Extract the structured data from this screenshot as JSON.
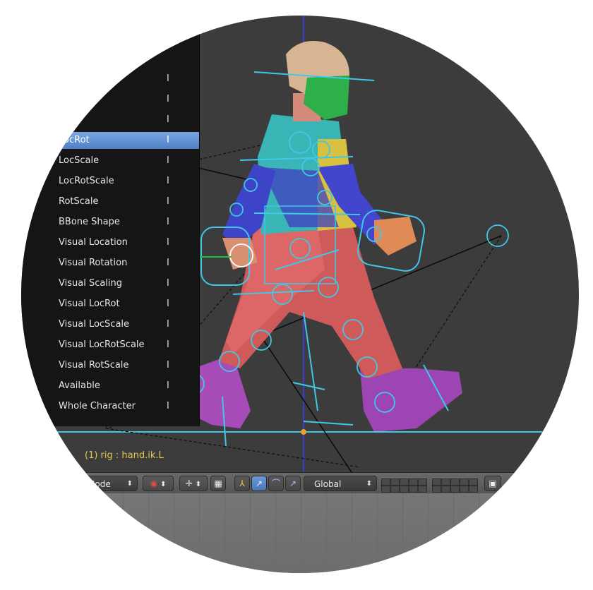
{
  "menu": {
    "items": [
      {
        "label": "",
        "shortcut": "I"
      },
      {
        "label": "",
        "shortcut": "I"
      },
      {
        "label": "",
        "shortcut": "I"
      },
      {
        "label": "LocRot",
        "shortcut": "I",
        "active": true
      },
      {
        "label": "LocScale",
        "shortcut": "I"
      },
      {
        "label": "LocRotScale",
        "shortcut": "I"
      },
      {
        "label": "RotScale",
        "shortcut": "I"
      },
      {
        "label": "BBone Shape",
        "shortcut": "I"
      },
      {
        "label": "Visual Location",
        "shortcut": "I"
      },
      {
        "label": "Visual Rotation",
        "shortcut": "I"
      },
      {
        "label": "Visual Scaling",
        "shortcut": "I"
      },
      {
        "label": "Visual LocRot",
        "shortcut": "I"
      },
      {
        "label": "Visual LocScale",
        "shortcut": "I"
      },
      {
        "label": "Visual LocRotScale",
        "shortcut": "I"
      },
      {
        "label": "Visual RotScale",
        "shortcut": "I"
      },
      {
        "label": "Available",
        "shortcut": "I"
      },
      {
        "label": "Whole Character",
        "shortcut": "I"
      }
    ]
  },
  "viewport": {
    "status": "(1) rig : hand.ik.L"
  },
  "header": {
    "mode_label": "Mode",
    "orientation_label": "Global"
  },
  "colors": {
    "active_item": "#5a8ad0",
    "bone_cyan": "#3fc8e8",
    "status_yellow": "#e3c84b"
  }
}
